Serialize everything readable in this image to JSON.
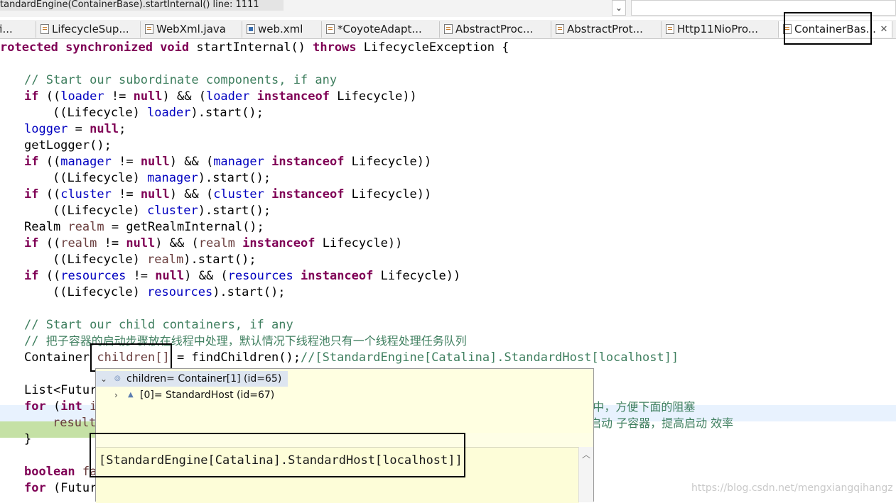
{
  "breadcrumb": {
    "text": "tandardEngine(ContainerBase).startInternal() line: 1111",
    "dropdown_glyph": "⌄"
  },
  "tabs": [
    {
      "label": "fi...",
      "icon": "java-file-icon"
    },
    {
      "label": "LifecycleSup...",
      "icon": "java-file-icon"
    },
    {
      "label": "WebXml.java",
      "icon": "java-file-icon"
    },
    {
      "label": "web.xml",
      "icon": "xml-file-icon"
    },
    {
      "label": "*CoyoteAdapt...",
      "icon": "java-file-icon"
    },
    {
      "label": "AbstractProc...",
      "icon": "java-file-icon"
    },
    {
      "label": "AbstractProt...",
      "icon": "java-file-icon"
    },
    {
      "label": "Http11NioPro...",
      "icon": "java-file-icon"
    },
    {
      "label": "ContainerBas...",
      "icon": "java-file-icon",
      "active": true
    }
  ],
  "tab_close_glyph": "✕",
  "code": {
    "l01": {
      "a": "rotected ",
      "b": "synchronized ",
      "c": "void ",
      "d": "startInternal() ",
      "e": "throws ",
      "f": "LifecycleException {"
    },
    "l03": {
      "a": "// Start our subordinate components, if any"
    },
    "l04": {
      "a": "if ",
      "b": "((",
      "c": "loader",
      "d": " != ",
      "e": "null",
      "f": ") && (",
      "g": "loader",
      "h": " instanceof ",
      "i": "Lifecycle))"
    },
    "l05": {
      "a": "((Lifecycle) ",
      "b": "loader",
      "c": ").start();"
    },
    "l06": {
      "a": "logger",
      "b": " = ",
      "c": "null",
      "d": ";"
    },
    "l07": {
      "a": "getLogger();"
    },
    "l08": {
      "a": "if ",
      "b": "((",
      "c": "manager",
      "d": " != ",
      "e": "null",
      "f": ") && (",
      "g": "manager",
      "h": " instanceof ",
      "i": "Lifecycle))"
    },
    "l09": {
      "a": "((Lifecycle) ",
      "b": "manager",
      "c": ").start();"
    },
    "l10": {
      "a": "if ",
      "b": "((",
      "c": "cluster",
      "d": " != ",
      "e": "null",
      "f": ") && (",
      "g": "cluster",
      "h": " instanceof ",
      "i": "Lifecycle))"
    },
    "l11": {
      "a": "((Lifecycle) ",
      "b": "cluster",
      "c": ").start();"
    },
    "l12": {
      "a": "Realm ",
      "b": "realm",
      "c": " = getRealmInternal();"
    },
    "l13": {
      "a": "if ",
      "b": "((",
      "c": "realm",
      "d": " != ",
      "e": "null",
      "f": ") && (",
      "g": "realm",
      "h": " instanceof ",
      "i": "Lifecycle))"
    },
    "l14": {
      "a": "((Lifecycle) ",
      "b": "realm",
      "c": ").start();"
    },
    "l15": {
      "a": "if ",
      "b": "((",
      "c": "resources",
      "d": " != ",
      "e": "null",
      "f": ") && (",
      "g": "resources",
      "h": " instanceof ",
      "i": "Lifecycle))"
    },
    "l16": {
      "a": "((Lifecycle) ",
      "b": "resources",
      "c": ").start();"
    },
    "l18": {
      "a": "// Start our child containers, if any"
    },
    "l19": {
      "a": "// ",
      "b": "把子容器的启动步骤放在线程中处理，默认情况下线程池只有一个线程处理任务队列"
    },
    "l20": {
      "a": "Container ",
      "b": "children[]",
      "c": " = findChildren();",
      "d": "//[StandardEngine[Catalina].StandardHost[localhost]]"
    },
    "l22": {
      "a": "List<Futur"
    },
    "l23": {
      "a": "for ",
      "b": "(",
      "c": "int ",
      "d": "i",
      "e": "s中，方便下面的阻塞"
    },
    "l24": {
      "a": "result",
      "b": "启动 子容器，提高启动 效率"
    },
    "l25": {
      "a": "}"
    },
    "l27": {
      "a": "boolean ",
      "b": "fa"
    },
    "l28": {
      "a": "for ",
      "b": "(Futur"
    }
  },
  "hover": {
    "root": "children= Container[1]  (id=65)",
    "child0": "[0]= StandardHost  (id=67)",
    "detail": "[StandardEngine[Catalina].StandardHost[localhost]]",
    "expanded_glyph": "⌄",
    "collapsed_glyph": "›"
  },
  "watermark": "https://blog.csdn.net/mengxiangqihangz"
}
